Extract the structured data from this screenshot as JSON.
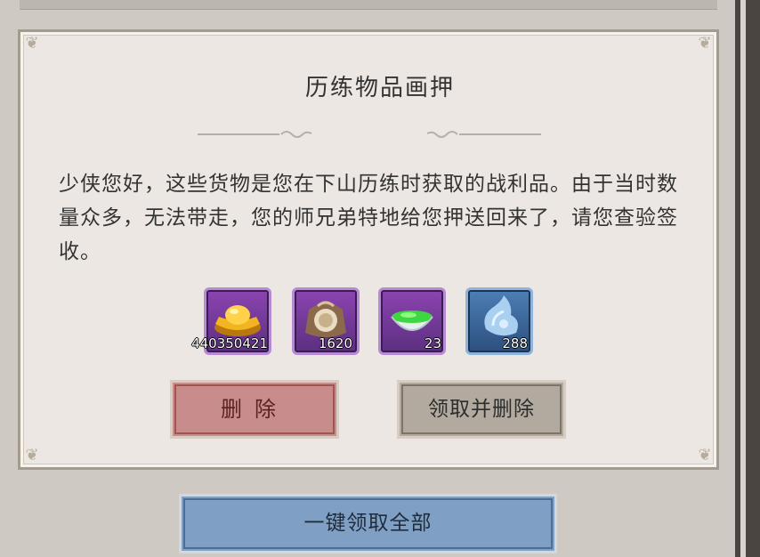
{
  "dialog": {
    "title": "历练物品画押",
    "message": "少侠您好，这些货物是您在下山历练时获取的战利品。由于当时数量众多，无法带走，您的师兄弟特地给您押送回来了，请您查验签收。"
  },
  "items": [
    {
      "icon": "gold-ingot-icon",
      "count": "440350421",
      "rarity": "purple"
    },
    {
      "icon": "coin-pouch-icon",
      "count": "1620",
      "rarity": "purple"
    },
    {
      "icon": "green-tea-bowl-icon",
      "count": "23",
      "rarity": "purple"
    },
    {
      "icon": "jade-ornament-icon",
      "count": "288",
      "rarity": "blue"
    }
  ],
  "buttons": {
    "delete": "删除",
    "claim_and_delete": "领取并删除",
    "claim_all": "一键领取全部"
  },
  "colors": {
    "panel_bg": "#ece7e2",
    "delete_button": "#c98c8c",
    "claim_delete_button": "#b2aa9f",
    "claim_all_button": "#7fa0c4",
    "purple_rarity": "#8c44b0",
    "blue_rarity": "#4d7eb5"
  }
}
